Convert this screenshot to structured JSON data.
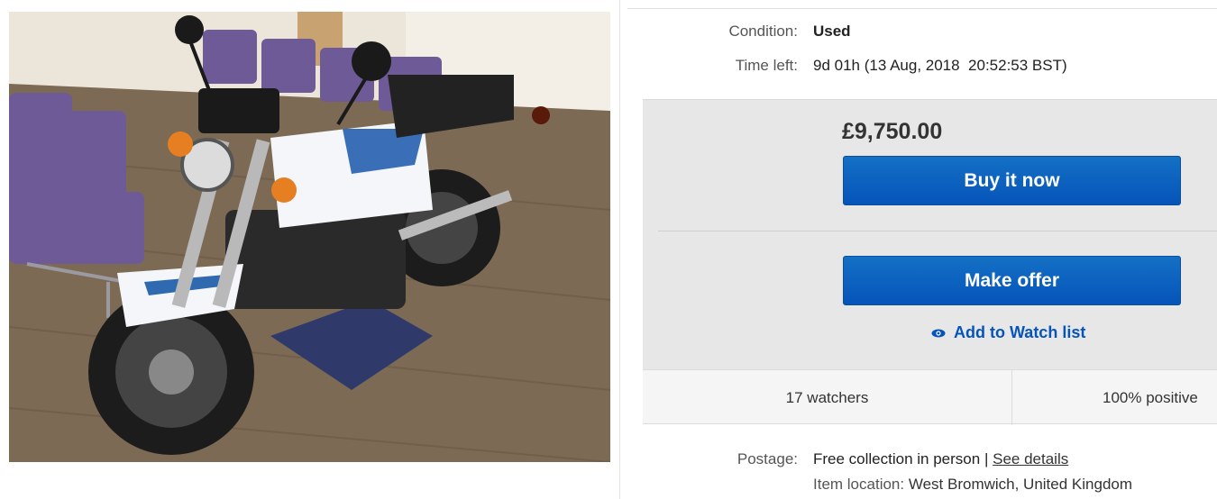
{
  "item": {
    "condition_label": "Condition:",
    "condition_value": "Used",
    "time_left_label": "Time left:",
    "time_left_value": "9d 01h (13 Aug, 2018  20:52:53 BST)"
  },
  "buy_box": {
    "price": "£9,750.00",
    "buy_now_label": "Buy it now",
    "make_offer_label": "Make offer",
    "watch_label": "Add to Watch list",
    "watch_icon": "eye-icon"
  },
  "stats": {
    "watchers": "17 watchers",
    "feedback": "100% positive"
  },
  "postage": {
    "label": "Postage:",
    "value": "Free collection in person",
    "separator": "|",
    "details_link": "See details",
    "location_label": "Item location:",
    "location_value": "West Bromwich, United Kingdom"
  },
  "colors": {
    "button_blue": "#0654ba",
    "link_blue": "#0654ba",
    "box_gray": "#e7e7e7"
  }
}
